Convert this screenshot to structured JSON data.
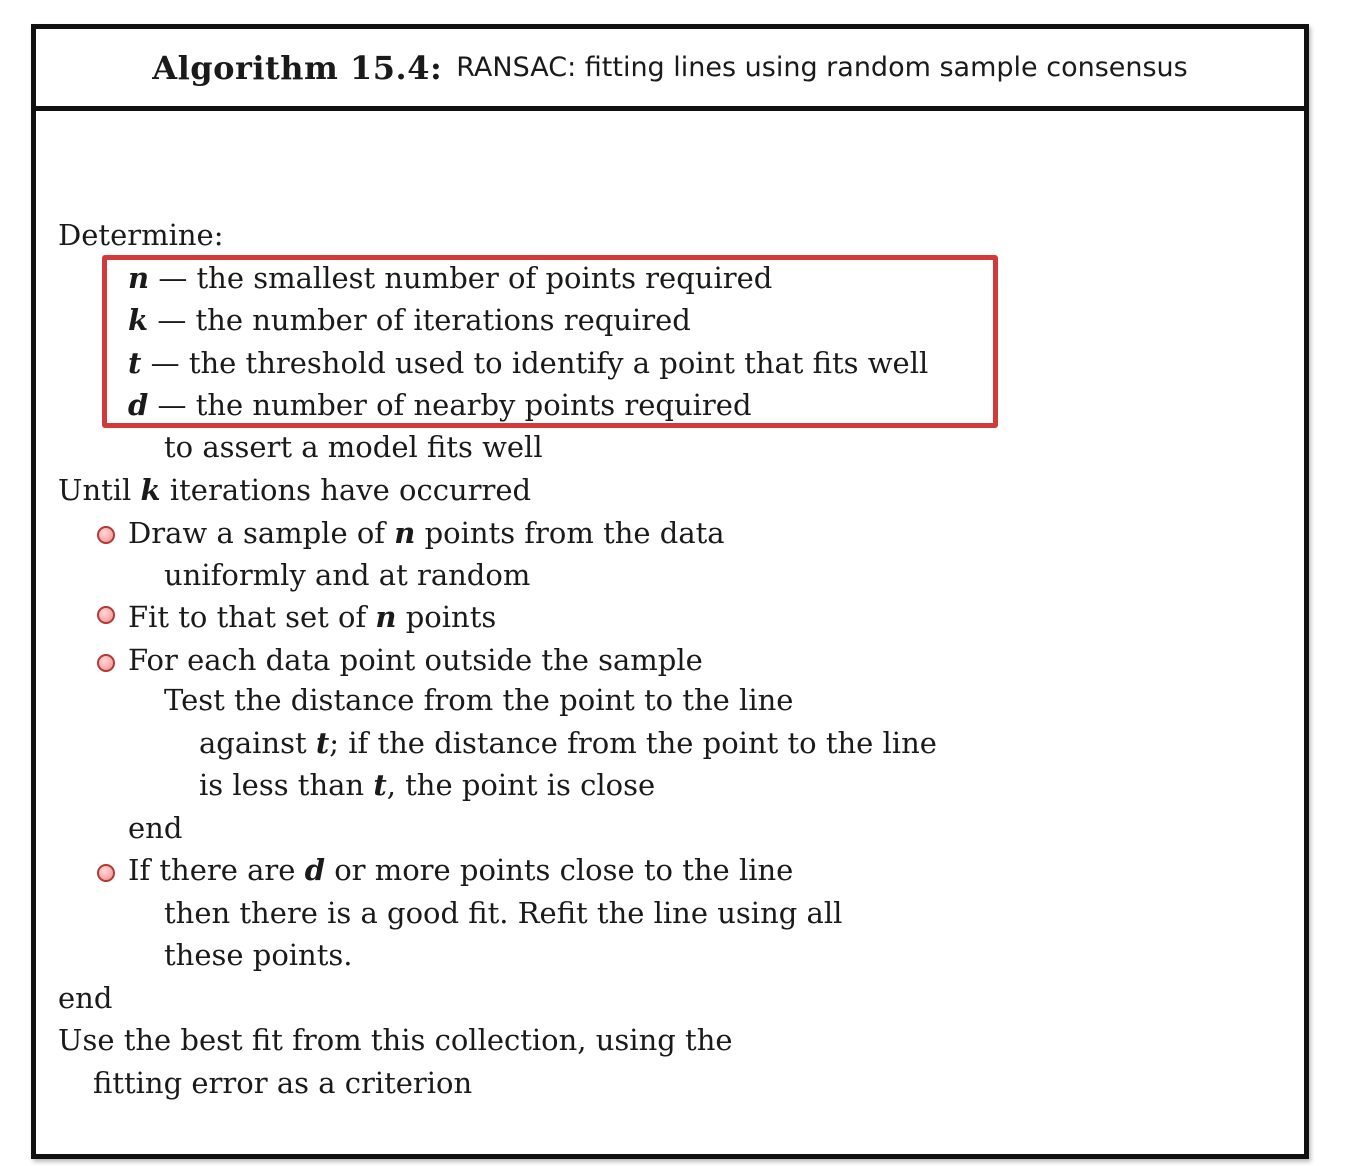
{
  "header": {
    "title_bold": "Algorithm 15.4:",
    "title_rest": "RANSAC: fitting lines using random sample consensus"
  },
  "determine": {
    "label": "Determine:",
    "params": [
      {
        "var": "n",
        "text": "— the smallest number of points required"
      },
      {
        "var": "k",
        "text": "— the number of iterations required"
      },
      {
        "var": "t",
        "text": "— the threshold used to identify a point that fits well"
      },
      {
        "var": "d",
        "text": "— the number of nearby points required"
      }
    ],
    "continuation": "to assert a model fits well"
  },
  "loop": {
    "until_pre": "Until",
    "until_var": "k",
    "until_post": "iterations have occurred",
    "steps": [
      {
        "line1_pre": "Draw a sample of",
        "line1_var": "n",
        "line1_post": "points from the data",
        "line2": "uniformly and at random"
      },
      {
        "line1_pre": "Fit to that set of",
        "line1_var": "n",
        "line1_post": "points"
      },
      {
        "line1": "For each data point outside the sample",
        "test_line": "Test the distance from the point to the line",
        "against_pre": "against",
        "against_var": "t",
        "against_post": "; if the distance from the point to the line",
        "less_pre": "is less than",
        "less_var": "t",
        "less_post": ", the point is close",
        "end_label": "end"
      },
      {
        "line1_pre": "If there are",
        "line1_var": "d",
        "line1_post": "or more points close to the line",
        "line2": "then there is a good fit. Refit the line using all",
        "line3": "these points."
      }
    ],
    "end_label": "end"
  },
  "final": {
    "line1": "Use the best fit from this collection, using the",
    "line2": "fitting error as a criterion"
  },
  "colors": {
    "highlight_border": "#d23a3a",
    "bullet_fill": "#f08a8a",
    "frame_border": "#111111"
  },
  "icons": {
    "bullet": "circle-bullet-icon"
  }
}
